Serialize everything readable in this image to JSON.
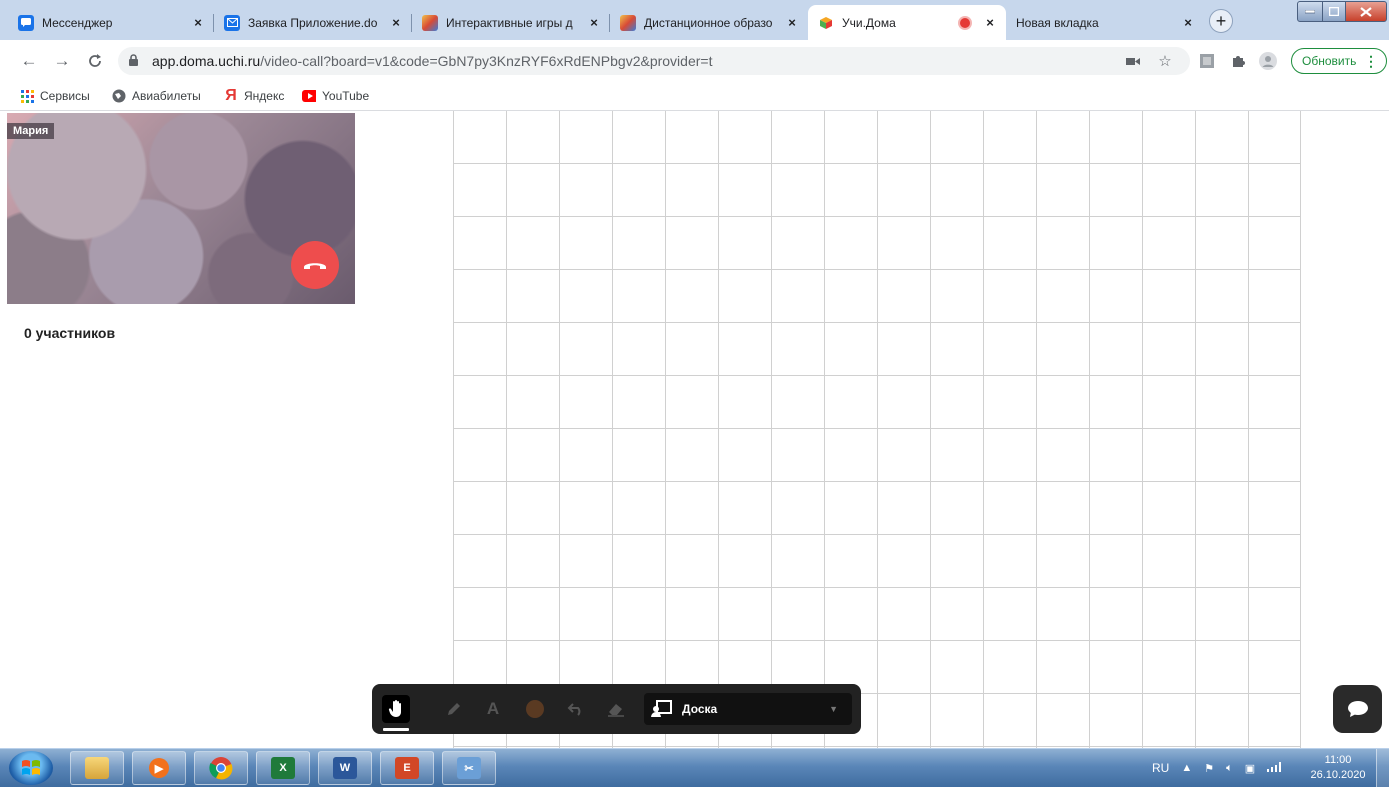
{
  "browser": {
    "tabs": [
      {
        "title": "Мессенджер",
        "favicon": "chat-icon",
        "color": "#1a73e8"
      },
      {
        "title": "Заявка Приложение.do",
        "favicon": "mail-icon",
        "color": "#1a73e8"
      },
      {
        "title": "Интерактивные игры д",
        "favicon": "games-icon",
        "color": "#d84b36"
      },
      {
        "title": "Дистанционное образо",
        "favicon": "games-icon",
        "color": "#d84b36"
      },
      {
        "title": "Учи.Дома",
        "favicon": "uchi-icon",
        "color": "#f5a623",
        "active": true,
        "recording": true
      },
      {
        "title": "Новая вкладка",
        "favicon": "",
        "color": ""
      }
    ],
    "new_tab_label": "+",
    "address": {
      "domain": "app.doma.uchi.ru",
      "path": "/video-call?board=v1&code=GbN7py3KnzRYF6xRdENPbgv2&provider=t"
    },
    "update_button": "Обновить",
    "bookmarks": [
      {
        "label": "Сервисы",
        "icon": "apps-grid-icon"
      },
      {
        "label": "Авиабилеты",
        "icon": "globe-icon"
      },
      {
        "label": "Яндекс",
        "icon": "yandex-icon"
      },
      {
        "label": "YouTube",
        "icon": "youtube-icon"
      }
    ]
  },
  "video": {
    "participant_name": "Мария"
  },
  "participants_label": "0 участников",
  "board_toolbar": {
    "text_tool": "A",
    "board_select_label": "Доска"
  },
  "taskbar": {
    "language": "RU",
    "time": "11:00",
    "date": "26.10.2020"
  }
}
